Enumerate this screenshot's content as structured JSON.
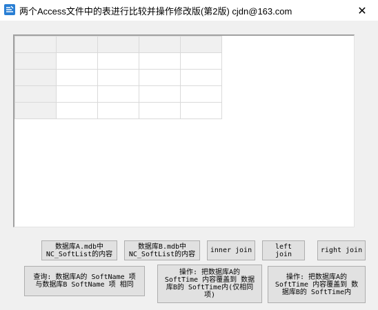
{
  "window": {
    "title": "两个Access文件中的表进行比较并操作修改版(第2版)   cjdn@163.com",
    "close_glyph": "✕"
  },
  "grid": {
    "rows": 5,
    "cols": 5
  },
  "buttons": {
    "db_a_contents": "数据库A.mdb中\nNC_SoftList的内容",
    "db_b_contents": "数据库B.mdb中\nNC_SoftList的内容",
    "inner_join": "inner join",
    "left_join": "left join",
    "right_join": "right join",
    "query_same_name": "查询: 数据库A的 SoftName 项\n与数据库B SoftName 项 相同",
    "op_overwrite_same": "操作: 把数据库A的\nSoftTime 内容覆盖到 数据\n库B的 SoftTime内(仅相同\n项)",
    "op_overwrite_all": "操作: 把数据库A的\nSoftTime 内容覆盖到 数\n据库B的 SoftTime内"
  },
  "icons": {
    "app": "app-table-icon",
    "close": "close-icon"
  }
}
